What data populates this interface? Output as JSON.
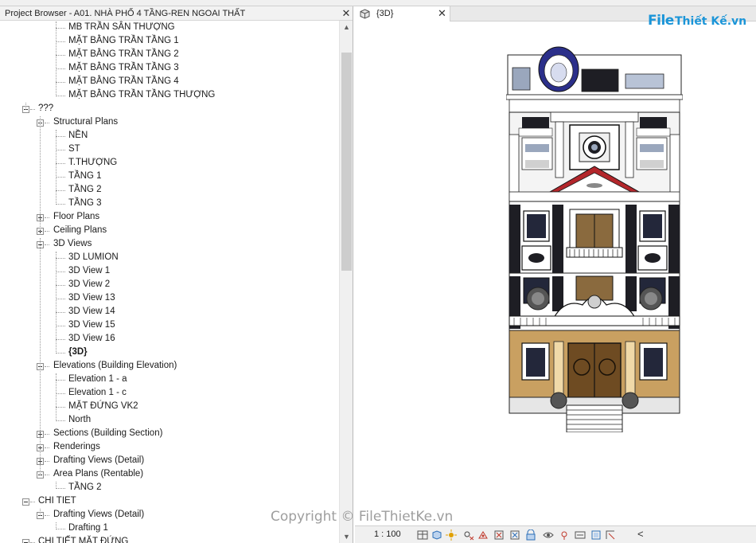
{
  "project_browser": {
    "title": "Project Browser - A01. NHÀ PHỐ 4 TẦNG-REN NGOAI THẤT",
    "close_glyph": "✕",
    "scroll_up": "▲",
    "scroll_down": "▼",
    "items": [
      {
        "label": "MB TRẦN SÂN THƯỢNG",
        "expander": "none"
      },
      {
        "label": "MẶT BẰNG TRẦN TẦNG 1",
        "expander": "none"
      },
      {
        "label": "MẶT BẰNG TRẦN TẦNG 2",
        "expander": "none"
      },
      {
        "label": "MẶT BẰNG TRẦN TẦNG 3",
        "expander": "none"
      },
      {
        "label": "MẶT BẰNG TRẦN TẦNG 4",
        "expander": "none"
      },
      {
        "label": "MẶT BẰNG TRẦN TẦNG THƯỢNG",
        "expander": "none"
      },
      {
        "label": "???",
        "expander": "minus"
      },
      {
        "label": "Structural Plans",
        "expander": "minus"
      },
      {
        "label": "NỀN",
        "expander": "none"
      },
      {
        "label": "ST",
        "expander": "none"
      },
      {
        "label": "T.THƯỢNG",
        "expander": "none"
      },
      {
        "label": "TẦNG 1",
        "expander": "none"
      },
      {
        "label": "TẦNG 2",
        "expander": "none"
      },
      {
        "label": "TẦNG 3",
        "expander": "none"
      },
      {
        "label": "Floor Plans",
        "expander": "plus"
      },
      {
        "label": "Ceiling Plans",
        "expander": "plus"
      },
      {
        "label": "3D Views",
        "expander": "minus"
      },
      {
        "label": "3D LUMION",
        "expander": "none"
      },
      {
        "label": "3D View 1",
        "expander": "none"
      },
      {
        "label": "3D View 2",
        "expander": "none"
      },
      {
        "label": "3D View 13",
        "expander": "none"
      },
      {
        "label": "3D View 14",
        "expander": "none"
      },
      {
        "label": "3D View 15",
        "expander": "none"
      },
      {
        "label": "3D View 16",
        "expander": "none"
      },
      {
        "label": "{3D}",
        "expander": "none",
        "active": true
      },
      {
        "label": "Elevations (Building Elevation)",
        "expander": "minus"
      },
      {
        "label": "Elevation 1 - a",
        "expander": "none"
      },
      {
        "label": "Elevation 1 - c",
        "expander": "none"
      },
      {
        "label": "MẶT ĐỨNG VK2",
        "expander": "none"
      },
      {
        "label": "North",
        "expander": "none"
      },
      {
        "label": "Sections (Building Section)",
        "expander": "plus"
      },
      {
        "label": "Renderings",
        "expander": "plus"
      },
      {
        "label": "Drafting Views (Detail)",
        "expander": "plus"
      },
      {
        "label": "Area Plans (Rentable)",
        "expander": "minus"
      },
      {
        "label": "TẦNG 2",
        "expander": "none"
      },
      {
        "label": "CHI TIET",
        "expander": "minus"
      },
      {
        "label": "Drafting Views (Detail)",
        "expander": "minus"
      },
      {
        "label": "Drafting 1",
        "expander": "none"
      },
      {
        "label": "CHI TIẾT MẶT ĐỨNG",
        "expander": "minus"
      }
    ]
  },
  "view_tab": {
    "label": "{3D}",
    "icon": "3d-view-icon",
    "close_glyph": "✕"
  },
  "logo": {
    "file_text": "File",
    "rest_text": "Thiết Kế.vn"
  },
  "watermark": "Copyright © FileThietKe.vn",
  "view_control_bar": {
    "scale": "1 : 100",
    "icons": [
      "detail-level-icon",
      "visual-style-icon",
      "sun-path-icon",
      "shadows-icon",
      "rendering-icon",
      "crop-view-icon",
      "show-crop-icon",
      "unlock-3d-icon",
      "temporary-hide-icon",
      "reveal-hidden-icon",
      "worksharing-icon",
      "analytical-model-icon",
      "highlight-displacement-icon"
    ],
    "chevron": "<"
  },
  "colors": {
    "panel_header": "#f2f2f2",
    "logo_blue": "#1b95d8",
    "roof_red": "#b3262b",
    "facade_wood": "#c9a061",
    "dark_window": "#1e1e24"
  }
}
